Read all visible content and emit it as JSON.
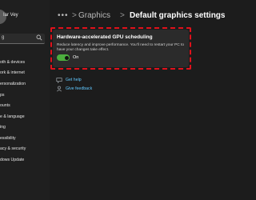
{
  "sidebar": {
    "user_name": "Iar Vey",
    "search_text": "g",
    "items": [
      {
        "label": "oth & devices"
      },
      {
        "label": "ork & internet"
      },
      {
        "label": "ersonalization"
      },
      {
        "label": "ps"
      },
      {
        "label": "ounts"
      },
      {
        "label": "e & language"
      },
      {
        "label": "ing"
      },
      {
        "label": "essibility"
      },
      {
        "label": "acy & security"
      },
      {
        "label": "dows Update"
      }
    ]
  },
  "header": {
    "ellipsis": "•••",
    "separator": ">",
    "parent": "Graphics",
    "title": "Default graphics settings"
  },
  "card": {
    "title": "Hardware-accelerated GPU scheduling",
    "description": "Reduce latency and improve performance. You'll need to restart your PC to have your changes take effect.",
    "toggle_state": "On"
  },
  "links": {
    "get_help": "Get help",
    "give_feedback": "Give feedback"
  },
  "colors": {
    "accent_green": "#4caf3e",
    "link_blue": "#60c8ff",
    "highlight_red": "#e0111b"
  }
}
